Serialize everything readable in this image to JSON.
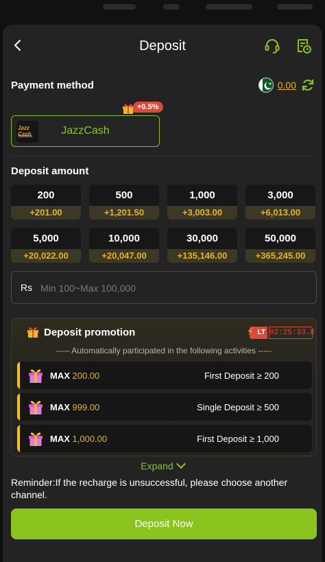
{
  "header": {
    "title": "Deposit",
    "icons": [
      "back-icon",
      "headset-icon",
      "history-icon"
    ]
  },
  "payment": {
    "label": "Payment method",
    "balance": "0.00",
    "method_name": "JazzCash",
    "method_logo_line1": "Jazz Cash",
    "method_logo_line2": "Business",
    "bonus_badge": "+0.5%"
  },
  "amount": {
    "label": "Deposit amount",
    "options": [
      {
        "value": "200",
        "bonus": "+201.00"
      },
      {
        "value": "500",
        "bonus": "+1,201.50"
      },
      {
        "value": "1,000",
        "bonus": "+3,003.00"
      },
      {
        "value": "3,000",
        "bonus": "+6,013.00"
      },
      {
        "value": "5,000",
        "bonus": "+20,022.00"
      },
      {
        "value": "10,000",
        "bonus": "+20,047.00"
      },
      {
        "value": "30,000",
        "bonus": "+135,146.00"
      },
      {
        "value": "50,000",
        "bonus": "+365,245.00"
      }
    ],
    "currency": "Rs",
    "placeholder": "Min 100~Max 100,000"
  },
  "promotion": {
    "title": "Deposit promotion",
    "lt_badge": "LT",
    "timer": "02:25:33.8",
    "subtitle": "----- Automatically participated in the following activities -----",
    "rows": [
      {
        "max_label": "MAX",
        "max_value": "200.00",
        "condition": "First Deposit ≥ 200"
      },
      {
        "max_label": "MAX",
        "max_value": "999.00",
        "condition": "Single Deposit ≥ 500"
      },
      {
        "max_label": "MAX",
        "max_value": "1,000.00",
        "condition": "First Deposit ≥ 1,000"
      }
    ],
    "expand_label": "Expand"
  },
  "reminder": "Reminder:If the recharge is unsuccessful, please choose another channel.",
  "deposit_button": "Deposit Now",
  "colors": {
    "accent": "#8bc41f",
    "gold": "#e6b422",
    "red": "#d94a3d"
  }
}
